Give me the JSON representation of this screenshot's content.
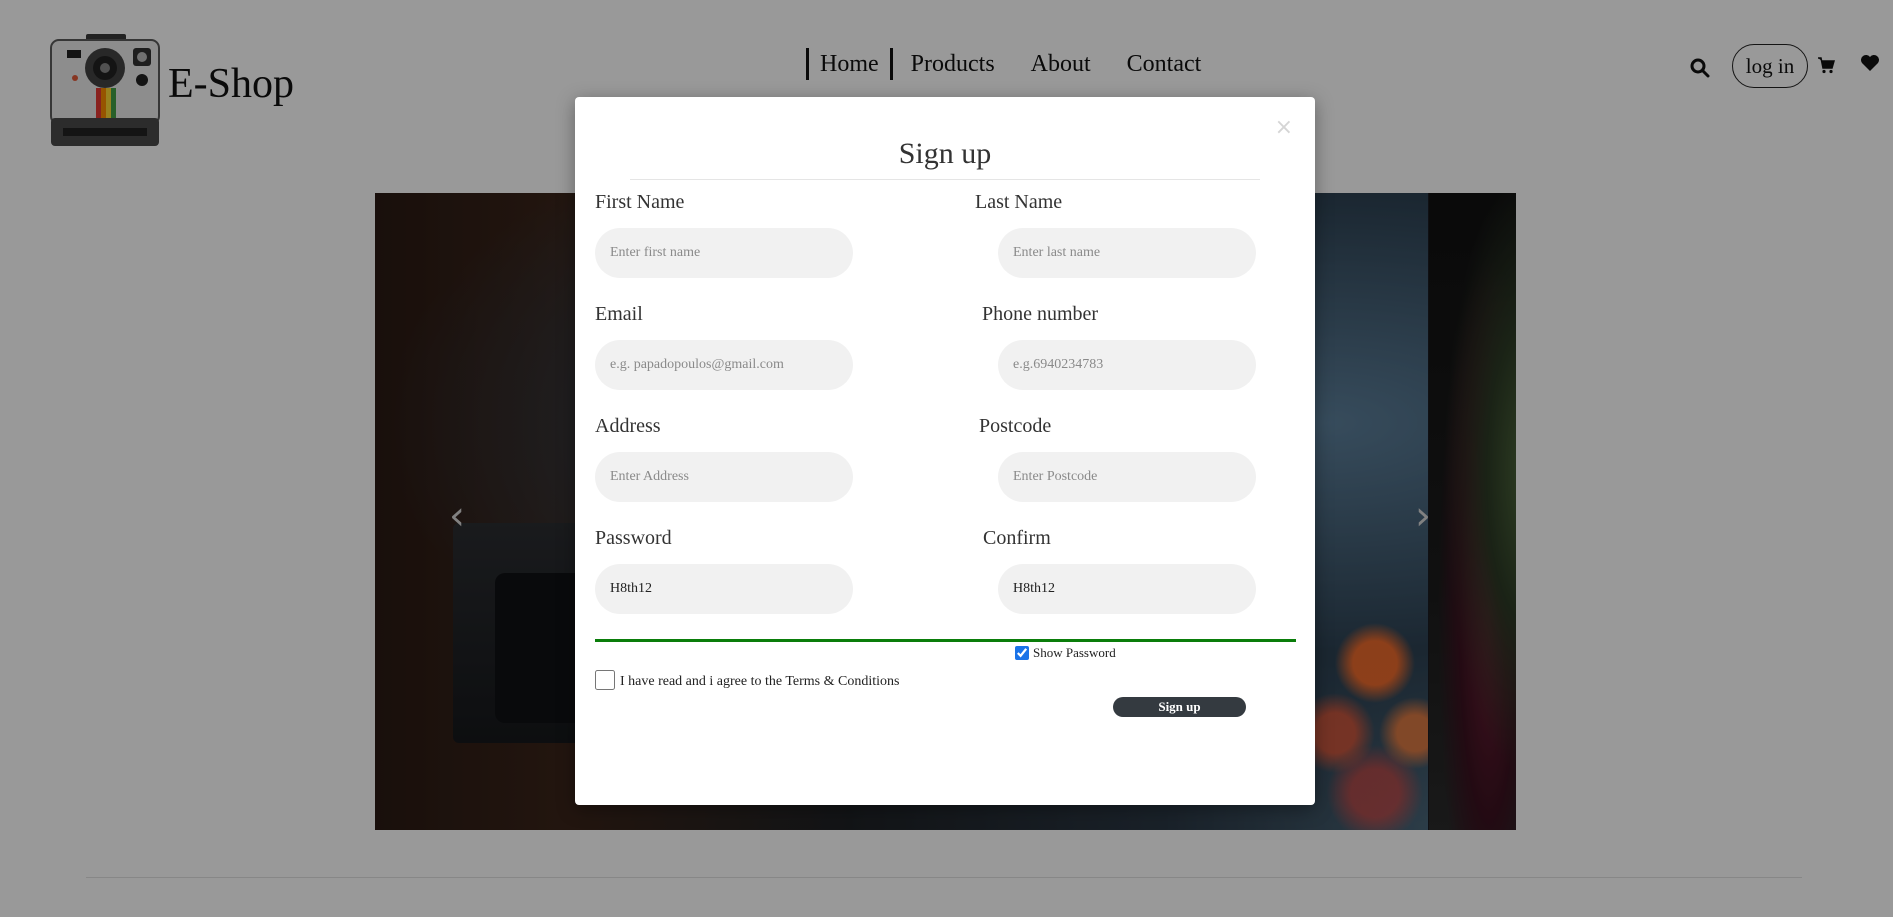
{
  "header": {
    "brand": "E-Shop",
    "nav": [
      "Home",
      "Products",
      "About",
      "Contact"
    ],
    "login_label": "log in",
    "icons": [
      "camera-logo-icon",
      "search-icon",
      "cart-icon",
      "heart-icon"
    ]
  },
  "carousel": {
    "prev_glyph": "‹",
    "next_glyph": "›"
  },
  "modal": {
    "title": "Sign up",
    "close_glyph": "×",
    "fields": {
      "first_name": {
        "label": "First Name",
        "placeholder": "Enter first name",
        "value": ""
      },
      "last_name": {
        "label": "Last Name",
        "placeholder": "Enter last name",
        "value": ""
      },
      "email": {
        "label": "Email",
        "placeholder": "e.g. papadopoulos@gmail.com",
        "value": ""
      },
      "phone": {
        "label": "Phone number",
        "placeholder": "e.g.6940234783",
        "value": ""
      },
      "address": {
        "label": "Address",
        "placeholder": "Enter Address",
        "value": ""
      },
      "postcode": {
        "label": "Postcode",
        "placeholder": "Enter Postcode",
        "value": ""
      },
      "password": {
        "label": "Password",
        "placeholder": "",
        "value": "H8th12"
      },
      "confirm": {
        "label": "Confirm",
        "placeholder": "",
        "value": "H8th12"
      }
    },
    "show_password_label": "Show Password",
    "show_password_checked": true,
    "terms_label": "I have read and i agree to the Terms & Conditions",
    "terms_checked": false,
    "submit_label": "Sign up",
    "strength_color": "#0a7d0a"
  }
}
